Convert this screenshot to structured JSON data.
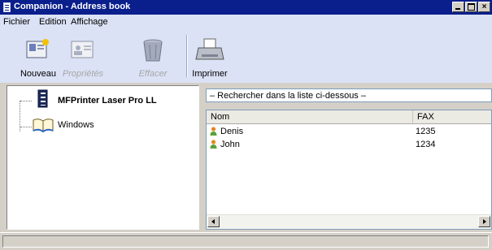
{
  "window": {
    "title": "Companion - Address book",
    "controls": [
      "_",
      "□",
      "×"
    ]
  },
  "menu": [
    "Fichier",
    "Edition",
    "Affichage"
  ],
  "toolbar": {
    "new_label": "Nouveau",
    "properties_label": "Propriétés",
    "delete_label": "Effacer",
    "print_label": "Imprimer"
  },
  "tree": {
    "printer_label": "MFPrinter Laser Pro LL",
    "windows_label": "Windows"
  },
  "search": {
    "label": "– Rechercher dans la liste ci-dessous –"
  },
  "list": {
    "columns": [
      "Nom",
      "FAX"
    ],
    "rows": [
      {
        "name": "Denis",
        "fax": "1235"
      },
      {
        "name": "John",
        "fax": "1234"
      }
    ]
  },
  "colors": {
    "titlebar": "#0a1f8c",
    "toolbar_bg": "#dbe2f5",
    "panel_bg": "#d4d0c8"
  }
}
